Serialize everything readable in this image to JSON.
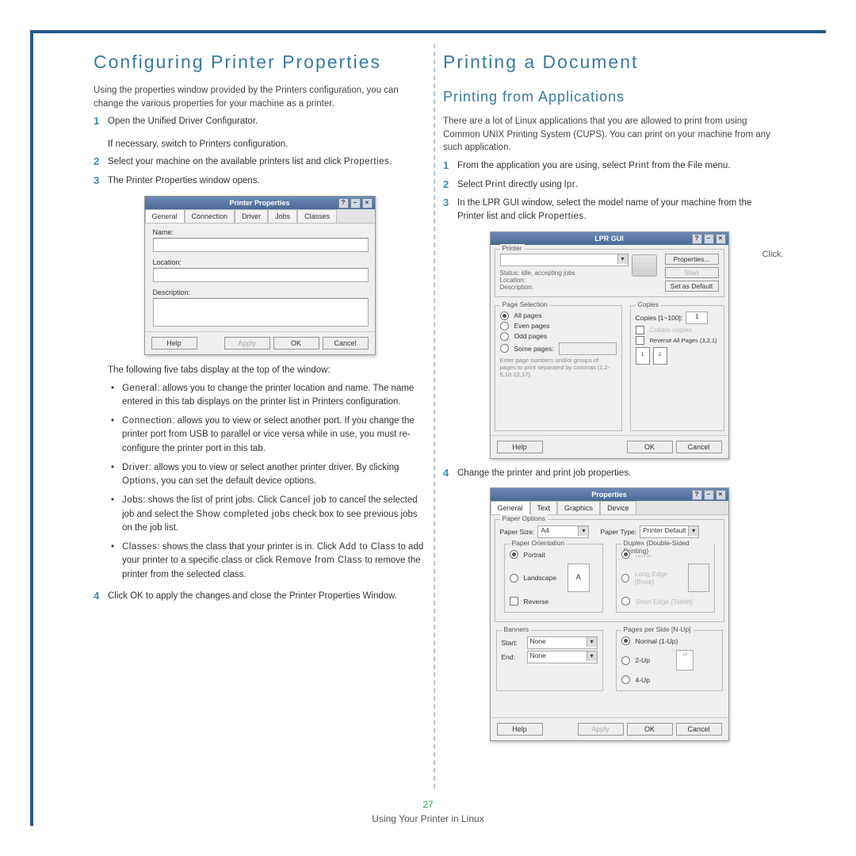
{
  "footer": {
    "page": "27",
    "line": "Using Your Printer in Linux"
  },
  "left": {
    "h1": "Configuring Printer Properties",
    "intro": "Using the properties window provided by the Printers configuration, you can change the various properties for your machine as a printer.",
    "s1": "Open the Unified Driver Configurator.",
    "s1b": "If necessary, switch to Printers configuration.",
    "s2a": "Select your machine on the available printers list and click ",
    "s2b": "Properties",
    "s2c": ".",
    "s3": "The Printer Properties window opens.",
    "mock1": {
      "title": "Printer Properties",
      "tabs": [
        "General",
        "Connection",
        "Driver",
        "Jobs",
        "Classes"
      ],
      "labels": {
        "name": "Name:",
        "location": "Location:",
        "desc": "Description:"
      },
      "btns": {
        "help": "Help",
        "apply": "Apply",
        "ok": "OK",
        "cancel": "Cancel"
      }
    },
    "after": "The following five tabs display at the top of the window:",
    "bul": {
      "g_h": "General",
      "g_t": ": allows you to change the printer location and name. The name entered in this tab displays on the printer list in Printers configuration.",
      "c_h": "Connection",
      "c_t": ": allows you to view or select another port. If you change the printer port from USB to parallel or vice versa while in use, you must re-configure the printer port in this tab.",
      "d_h": "Driver",
      "d_t": ": allows you to view or select another printer driver. By clicking ",
      "d_opt": "Options",
      "d_t2": ", you can set the default device options.",
      "j_h": "Jobs",
      "j_t": ": shows the list of print jobs. Click ",
      "j_cj": "Cancel job",
      "j_t2": " to cancel the selected job and select the ",
      "j_sc": "Show completed jobs",
      "j_t3": " check box to see previous jobs on the job list.",
      "cl_h": "Classes",
      "cl_t": ": shows the class that your printer is in. Click ",
      "cl_a": "Add to Class",
      "cl_t2": " to add your printer to a specific class or click ",
      "cl_r": "Remove from Class",
      "cl_t3": " to remove the printer from the selected class."
    },
    "s4": "Click OK to apply the changes and close the Printer Properties Window."
  },
  "right": {
    "h1": "Printing a Document",
    "h2": "Printing from Applications",
    "intro": "There are a lot of Linux applications that you are allowed to print from using Common UNIX Printing System (CUPS). You can print on your machine from any such application.",
    "s1a": "From the application you are using, select ",
    "s1b": "Print",
    "s1c": " from the File menu.",
    "s2a": "Select ",
    "s2b": "Print",
    "s2c": " directly using ",
    "s2d": "lpr",
    "s2e": ".",
    "s3a": "In the LPR GUI window, select the model name of your machine from the Printer list and click ",
    "s3b": "Properties",
    "s3c": ".",
    "callout": "Click.",
    "mock2": {
      "title": "LPR GUI",
      "printer": "Printer",
      "status": "Status: idle, accepting jobs",
      "loc": "Location:",
      "desc": "Description:",
      "btns": {
        "props": "Properties...",
        "start": "Start",
        "setdef": "Set as Default"
      },
      "page_sel": "Page Selection",
      "all": "All pages",
      "even": "Even pages",
      "odd": "Odd pages",
      "some": "Some pages:",
      "hint": "Enter page numbers and/or groups of pages to print separated by commas (1,2-5,10-12,17).",
      "copies": "Copies",
      "copies_lbl": "Copies [1~100]:",
      "copies_val": "1",
      "collate": "Collate copies",
      "rev": "Reverse All Pages (3,2,1)",
      "help": "Help",
      "ok": "OK",
      "cancel": "Cancel"
    },
    "s4": "Change the printer and print job properties.",
    "mock3": {
      "title": "Properties",
      "tabs": [
        "General",
        "Text",
        "Graphics",
        "Device"
      ],
      "paper_opt": "Paper Options",
      "paper_size": "Paper Size:",
      "a4": "A4",
      "paper_type": "Paper Type:",
      "pdef": "Printer Default",
      "orient": "Paper Orientation",
      "portrait": "Portrait",
      "landscape": "Landscape",
      "reverse": "Reverse",
      "duplex": "Duplex (Double-Sided Printing)",
      "d_none": "None",
      "d_long": "Long Edge [Book]",
      "d_short": "Short Edge [Tablet]",
      "banners": "Banners",
      "start": "Start:",
      "end": "End:",
      "none": "None",
      "pps": "Pages per Side [N-Up]",
      "n1": "Normal (1-Up)",
      "n2": "2-Up",
      "n4": "4-Up",
      "help": "Help",
      "apply": "Apply",
      "ok": "OK",
      "cancel": "Cancel"
    }
  }
}
